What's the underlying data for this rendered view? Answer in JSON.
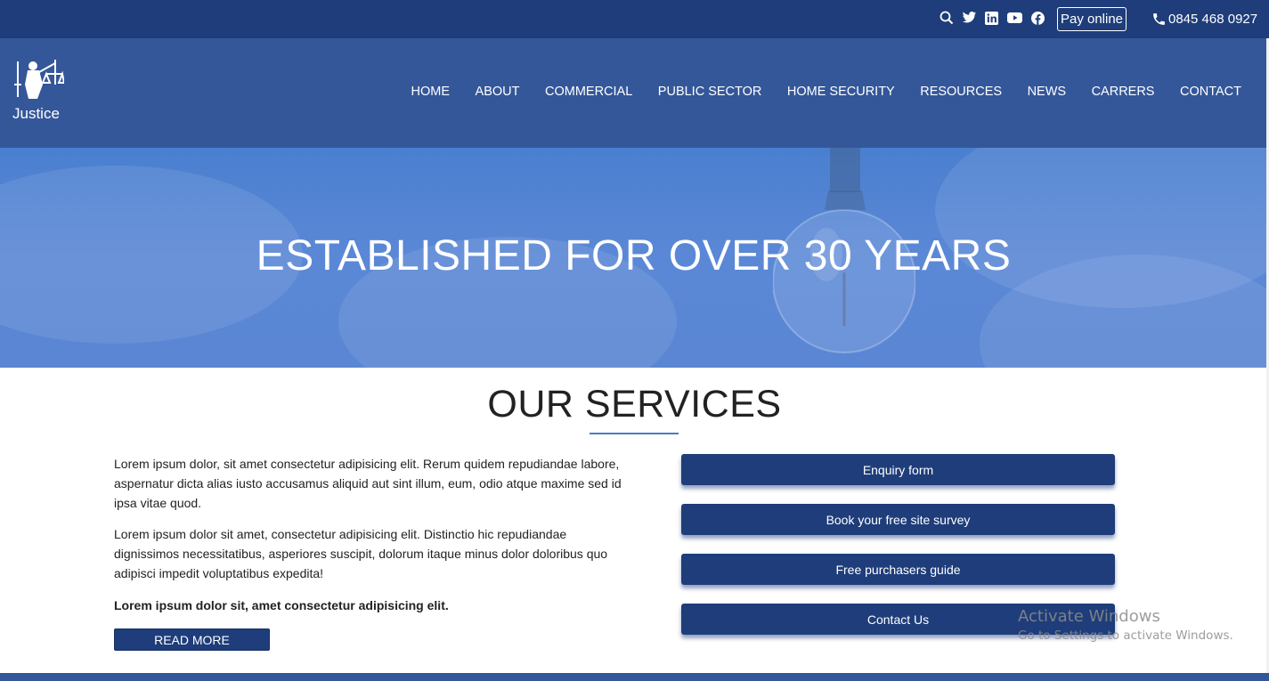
{
  "topbar": {
    "icons": [
      "search-icon",
      "twitter-icon",
      "linkedin-icon",
      "youtube-icon",
      "facebook-icon"
    ],
    "pay_label": "Pay online",
    "phone_icon": "phone-icon",
    "phone": "0845 468 0927"
  },
  "brand": {
    "name": "Justice",
    "logo_icon": "lady-justice-icon"
  },
  "nav": {
    "items": [
      "HOME",
      "ABOUT",
      "COMMERCIAL",
      "PUBLIC SECTOR",
      "HOME SECURITY",
      "RESOURCES",
      "NEWS",
      "CARRERS",
      "CONTACT"
    ]
  },
  "hero": {
    "title": "ESTABLISHED FOR OVER 30 YEARS"
  },
  "services": {
    "title": "OUR SERVICES",
    "paragraphs": [
      "Lorem ipsum dolor, sit amet consectetur adipisicing elit. Rerum quidem repudiandae labore, aspernatur dicta alias iusto accusamus aliquid aut sint illum, eum, odio atque maxime sed id ipsa vitae quod.",
      "Lorem ipsum dolor sit amet, consectetur adipisicing elit. Distinctio hic repudiandae dignissimos necessitatibus, asperiores suscipit, dolorum itaque minus dolor doloribus quo adipisci impedit voluptatibus expedita!",
      "Lorem ipsum dolor sit, amet consectetur adipisicing elit."
    ],
    "read_more": "READ MORE",
    "buttons": [
      "Enquiry form",
      "Book your free site survey",
      "Free purchasers guide",
      "Contact Us"
    ]
  },
  "os_watermark": {
    "line1": "Activate Windows",
    "line2": "Go to Settings to activate Windows."
  },
  "colors": {
    "dark_blue": "#1e3d7a",
    "nav_blue": "#34579a",
    "hero_blue": "#5a86d3",
    "accent": "#4a7bc6"
  }
}
